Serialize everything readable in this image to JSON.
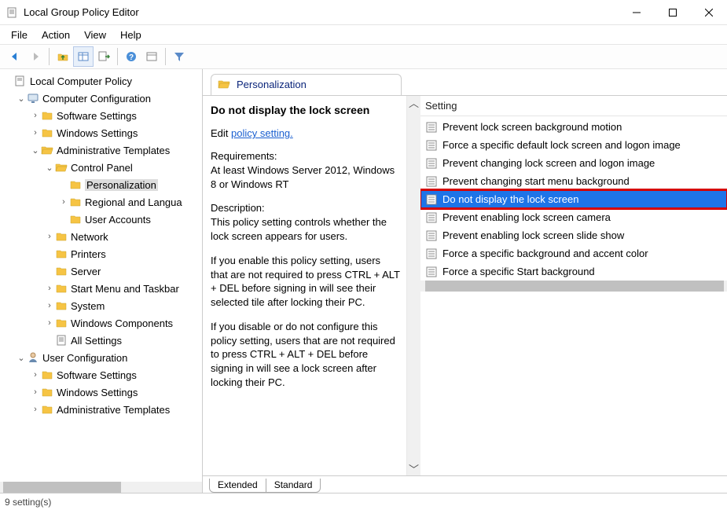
{
  "window": {
    "title": "Local Group Policy Editor"
  },
  "menubar": {
    "items": [
      "File",
      "Action",
      "View",
      "Help"
    ]
  },
  "tree": {
    "root": "Local Computer Policy",
    "nodes": [
      {
        "label": "Computer Configuration",
        "level": 1,
        "expanded": true,
        "icon": "computer"
      },
      {
        "label": "Software Settings",
        "level": 2,
        "expanded": false,
        "icon": "folder",
        "hasChildren": true
      },
      {
        "label": "Windows Settings",
        "level": 2,
        "expanded": false,
        "icon": "folder",
        "hasChildren": true
      },
      {
        "label": "Administrative Templates",
        "level": 2,
        "expanded": true,
        "icon": "folder-open",
        "hasChildren": true
      },
      {
        "label": "Control Panel",
        "level": 3,
        "expanded": true,
        "icon": "folder-open",
        "hasChildren": true
      },
      {
        "label": "Personalization",
        "level": 4,
        "expanded": false,
        "icon": "folder",
        "hasChildren": false,
        "selected": true
      },
      {
        "label": "Regional and Langua",
        "level": 4,
        "expanded": false,
        "icon": "folder",
        "hasChildren": true
      },
      {
        "label": "User Accounts",
        "level": 4,
        "expanded": false,
        "icon": "folder",
        "hasChildren": false
      },
      {
        "label": "Network",
        "level": 3,
        "expanded": false,
        "icon": "folder",
        "hasChildren": true
      },
      {
        "label": "Printers",
        "level": 3,
        "expanded": false,
        "icon": "folder",
        "hasChildren": false
      },
      {
        "label": "Server",
        "level": 3,
        "expanded": false,
        "icon": "folder",
        "hasChildren": false
      },
      {
        "label": "Start Menu and Taskbar",
        "level": 3,
        "expanded": false,
        "icon": "folder",
        "hasChildren": true
      },
      {
        "label": "System",
        "level": 3,
        "expanded": false,
        "icon": "folder",
        "hasChildren": true
      },
      {
        "label": "Windows Components",
        "level": 3,
        "expanded": false,
        "icon": "folder",
        "hasChildren": true
      },
      {
        "label": "All Settings",
        "level": 3,
        "expanded": false,
        "icon": "sheet",
        "hasChildren": false
      },
      {
        "label": "User Configuration",
        "level": 1,
        "expanded": true,
        "icon": "user"
      },
      {
        "label": "Software Settings",
        "level": 2,
        "expanded": false,
        "icon": "folder",
        "hasChildren": true
      },
      {
        "label": "Windows Settings",
        "level": 2,
        "expanded": false,
        "icon": "folder",
        "hasChildren": true
      },
      {
        "label": "Administrative Templates",
        "level": 2,
        "expanded": false,
        "icon": "folder",
        "hasChildren": true
      }
    ]
  },
  "header": {
    "title": "Personalization"
  },
  "detail": {
    "heading": "Do not display the lock screen",
    "edit_prefix": "Edit ",
    "edit_link": "policy setting.",
    "req_label": "Requirements:",
    "req_text": "At least Windows Server 2012, Windows 8 or Windows RT",
    "desc_label": "Description:",
    "desc_p1": "This policy setting controls whether the lock screen appears for users.",
    "desc_p2": "If you enable this policy setting, users that are not required to press CTRL + ALT + DEL before signing in will see their selected tile after locking their PC.",
    "desc_p3": "If you disable or do not configure this policy setting, users that are not required to press CTRL + ALT + DEL before signing in will see a lock screen after locking their PC."
  },
  "list": {
    "col_header": "Setting",
    "items": [
      {
        "label": "Prevent lock screen background motion",
        "selected": false
      },
      {
        "label": "Force a specific default lock screen and logon image",
        "selected": false
      },
      {
        "label": "Prevent changing lock screen and logon image",
        "selected": false
      },
      {
        "label": "Prevent changing start menu background",
        "selected": false
      },
      {
        "label": "Do not display the lock screen",
        "selected": true
      },
      {
        "label": "Prevent enabling lock screen camera",
        "selected": false
      },
      {
        "label": "Prevent enabling lock screen slide show",
        "selected": false
      },
      {
        "label": "Force a specific background and accent color",
        "selected": false
      },
      {
        "label": "Force a specific Start background",
        "selected": false
      }
    ]
  },
  "bottom_tabs": {
    "extended": "Extended",
    "standard": "Standard"
  },
  "statusbar": {
    "text": "9 setting(s)"
  }
}
